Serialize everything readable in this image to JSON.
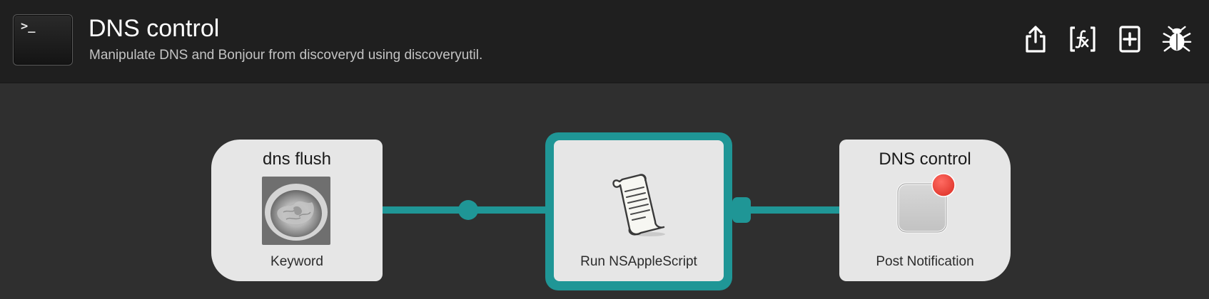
{
  "header": {
    "title": "DNS control",
    "subtitle": "Manipulate DNS and Bonjour from discoveryd using discoveryutil.",
    "icon": "terminal-icon",
    "icon_prompt": ">_",
    "toolbar": [
      {
        "icon": "share-icon"
      },
      {
        "icon": "variable-icon"
      },
      {
        "icon": "add-object-icon"
      },
      {
        "icon": "debug-bug-icon"
      }
    ]
  },
  "nodes": {
    "trigger": {
      "title": "dns flush",
      "label": "Keyword",
      "icon": "toilet-photo-icon"
    },
    "action": {
      "title": "",
      "label": "Run NSAppleScript",
      "icon": "script-scroll-icon"
    },
    "output": {
      "title": "DNS control",
      "label": "Post Notification",
      "icon": "notification-icon"
    }
  },
  "colors": {
    "header_bg": "#1f1f1f",
    "canvas_bg": "#2f2f2f",
    "connection": "#1f9696",
    "node_bg": "#e6e6e6",
    "badge": "#e9433a"
  }
}
